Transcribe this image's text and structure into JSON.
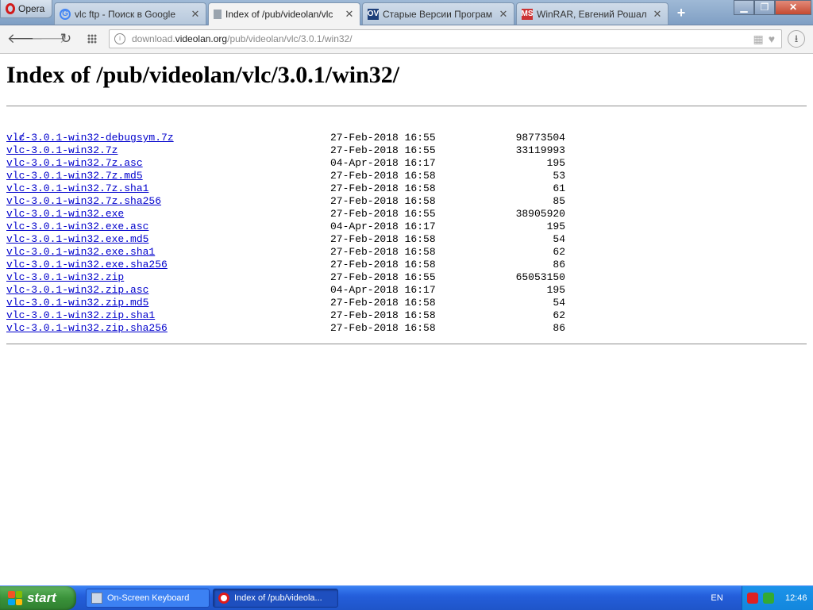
{
  "browser": {
    "menu_label": "Opera",
    "tabs": [
      {
        "label": "vlc ftp - Поиск в Google",
        "icon": "google-icon"
      },
      {
        "label": "Index of /pub/videolan/vlc",
        "icon": "document-icon",
        "active": true
      },
      {
        "label": "Старые Версии Програм",
        "icon": "ov-icon",
        "icon_text": "OV"
      },
      {
        "label": "WinRAR, Евгений Рошал",
        "icon": "ms-icon",
        "icon_text": "MS"
      }
    ],
    "address": {
      "prefix": "download.",
      "host": "videolan.org",
      "path": "/pub/videolan/vlc/3.0.1/win32/"
    }
  },
  "page": {
    "title": "Index of /pub/videolan/vlc/3.0.1/win32/",
    "parent_link": "../",
    "files": [
      {
        "name": "vlc-3.0.1-win32-debugsym.7z",
        "date": "27-Feb-2018 16:55",
        "size": "98773504"
      },
      {
        "name": "vlc-3.0.1-win32.7z",
        "date": "27-Feb-2018 16:55",
        "size": "33119993"
      },
      {
        "name": "vlc-3.0.1-win32.7z.asc",
        "date": "04-Apr-2018 16:17",
        "size": "195"
      },
      {
        "name": "vlc-3.0.1-win32.7z.md5",
        "date": "27-Feb-2018 16:58",
        "size": "53"
      },
      {
        "name": "vlc-3.0.1-win32.7z.sha1",
        "date": "27-Feb-2018 16:58",
        "size": "61"
      },
      {
        "name": "vlc-3.0.1-win32.7z.sha256",
        "date": "27-Feb-2018 16:58",
        "size": "85"
      },
      {
        "name": "vlc-3.0.1-win32.exe",
        "date": "27-Feb-2018 16:55",
        "size": "38905920"
      },
      {
        "name": "vlc-3.0.1-win32.exe.asc",
        "date": "04-Apr-2018 16:17",
        "size": "195"
      },
      {
        "name": "vlc-3.0.1-win32.exe.md5",
        "date": "27-Feb-2018 16:58",
        "size": "54"
      },
      {
        "name": "vlc-3.0.1-win32.exe.sha1",
        "date": "27-Feb-2018 16:58",
        "size": "62"
      },
      {
        "name": "vlc-3.0.1-win32.exe.sha256",
        "date": "27-Feb-2018 16:58",
        "size": "86"
      },
      {
        "name": "vlc-3.0.1-win32.zip",
        "date": "27-Feb-2018 16:55",
        "size": "65053150"
      },
      {
        "name": "vlc-3.0.1-win32.zip.asc",
        "date": "04-Apr-2018 16:17",
        "size": "195"
      },
      {
        "name": "vlc-3.0.1-win32.zip.md5",
        "date": "27-Feb-2018 16:58",
        "size": "54"
      },
      {
        "name": "vlc-3.0.1-win32.zip.sha1",
        "date": "27-Feb-2018 16:58",
        "size": "62"
      },
      {
        "name": "vlc-3.0.1-win32.zip.sha256",
        "date": "27-Feb-2018 16:58",
        "size": "86"
      }
    ]
  },
  "taskbar": {
    "start_label": "start",
    "tasks": [
      {
        "label": "On-Screen Keyboard"
      },
      {
        "label": "Index of /pub/videola..."
      }
    ],
    "language": "EN",
    "clock": "12:46"
  },
  "colors": {
    "link": "#0000cc",
    "taskbar": "#245edb",
    "start": "#3a923a"
  }
}
